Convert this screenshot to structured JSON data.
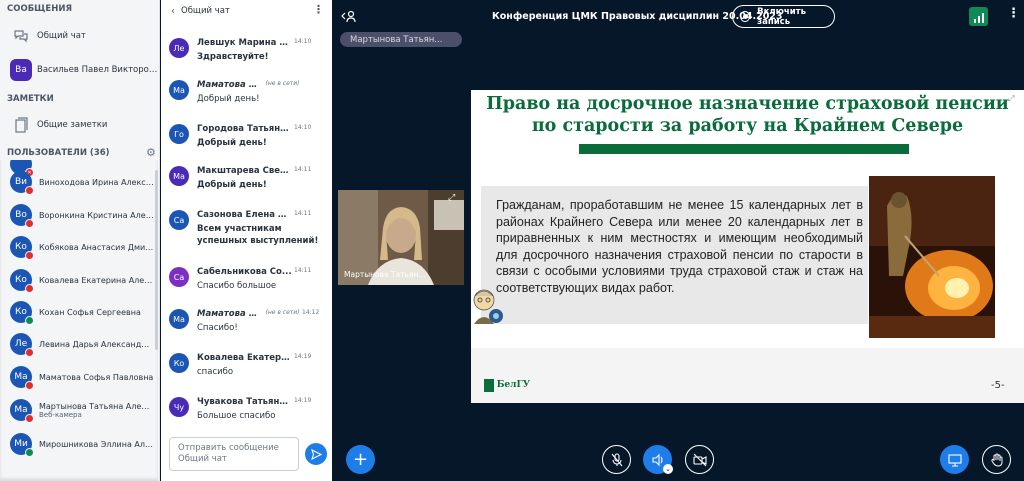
{
  "sidebar": {
    "messages_header": "СООБЩЕНИЯ",
    "public_chat": "Общий чат",
    "private_chat": {
      "initials": "Ва",
      "name": "Васильев Павел Викторович"
    },
    "notes_header": "ЗАМЕТКИ",
    "shared_notes": "Общие заметки",
    "users_header": "ПОЛЬЗОВАТЕЛИ (36)",
    "users": [
      {
        "initials": "Ви",
        "name": "Виноходова Ирина Александр...",
        "color": "#1b56b4",
        "status": "red",
        "sub": ""
      },
      {
        "initials": "Во",
        "name": "Воронкина Кристина Александ...",
        "color": "#1b56b4",
        "status": "red",
        "sub": ""
      },
      {
        "initials": "Ко",
        "name": "Кобякова Анастасия Дмитриев...",
        "color": "#1b56b4",
        "status": "red",
        "sub": ""
      },
      {
        "initials": "Ко",
        "name": "Ковалева Екатерина Александ...",
        "color": "#1b56b4",
        "status": "red",
        "sub": ""
      },
      {
        "initials": "Ко",
        "name": "Кохан Софья Сергеевна",
        "color": "#1b56b4",
        "status": "green",
        "sub": ""
      },
      {
        "initials": "Ле",
        "name": "Левина Дарья Александровна",
        "color": "#1b56b4",
        "status": "red",
        "sub": ""
      },
      {
        "initials": "Ма",
        "name": "Маматова Софья Павловна",
        "color": "#1b56b4",
        "status": "red",
        "sub": ""
      },
      {
        "initials": "Ма",
        "name": "Мартынова Татьяна Александ...",
        "color": "#1b56b4",
        "status": "red",
        "sub": "Веб-камера"
      },
      {
        "initials": "Ми",
        "name": "Мирошникова Эллина Алексан...",
        "color": "#1b56b4",
        "status": "green",
        "sub": ""
      }
    ]
  },
  "chat": {
    "title": "Общий чат",
    "messages": [
      {
        "initials": "Ле",
        "color": "#4a2bb5",
        "name": "Левшук Марина В...",
        "time": "14:10",
        "text": "Здравствуйте!",
        "bold": true,
        "italic": false,
        "offline": ""
      },
      {
        "initials": "Ма",
        "color": "#1b56b4",
        "name": "Маматова С...",
        "time": "",
        "text": "Добрый день!",
        "bold": false,
        "italic": true,
        "offline": "(не в сети)"
      },
      {
        "initials": "Го",
        "color": "#1b56b4",
        "name": "Городова Татьяна ...",
        "time": "14:10",
        "text": "Добрый день!",
        "bold": true,
        "italic": false,
        "offline": ""
      },
      {
        "initials": "Ма",
        "color": "#4a2bb5",
        "name": "Макштарева Свет...",
        "time": "14:11",
        "text": "Добрый день!",
        "bold": true,
        "italic": false,
        "offline": ""
      },
      {
        "initials": "Са",
        "color": "#1b56b4",
        "name": "Сазонова Елена С...",
        "time": "14:11",
        "text": "Всем участникам успешных выступлений!",
        "bold": true,
        "italic": false,
        "offline": ""
      },
      {
        "initials": "Са",
        "color": "#7c2fc2",
        "name": "Сабельникова Со...",
        "time": "14:11",
        "text": "Спасибо большое",
        "bold": false,
        "italic": false,
        "offline": ""
      },
      {
        "initials": "Ма",
        "color": "#1b56b4",
        "name": "Маматова С...",
        "time": "14:12",
        "text": "Спасибо!",
        "bold": false,
        "italic": true,
        "offline": "(не в сети)"
      },
      {
        "initials": "Ко",
        "color": "#1b56b4",
        "name": "Ковалева Екатери...",
        "time": "14:19",
        "text": "спасибо",
        "bold": false,
        "italic": false,
        "offline": ""
      },
      {
        "initials": "Чу",
        "color": "#4a2bb5",
        "name": "Чувакова Татьяна ...",
        "time": "14:19",
        "text": "Большое спасибо",
        "bold": false,
        "italic": false,
        "offline": ""
      }
    ],
    "input_placeholder_1": "Отправить сообщение",
    "input_placeholder_2": "Общий чат"
  },
  "main": {
    "conference_title": "Конференция ЦМК Правовых дисциплин 20.04.2023",
    "record_label": "Включить запись",
    "presenter_pill": "Мартынова Татьян...",
    "webcam_label": "Мартынова Татьян..."
  },
  "slide": {
    "title_line1": "Право на досрочное назначение страховой пенсии",
    "title_line2": "по старости за работу на Крайнем Севере",
    "body": "Гражданам, проработавшим не менее 15 календарных лет в районах Крайнего Севера или менее 20 календарных лет в приравненных к ним местностях и имеющим необходимый для досрочного назначения страховой пенсии по старости в связи с особыми условиями труда страховой стаж и стаж на соответствующих видах работ.",
    "logo_text": "БелГУ",
    "page_number": "-5-",
    "accent_color": "#0a6b3b"
  }
}
